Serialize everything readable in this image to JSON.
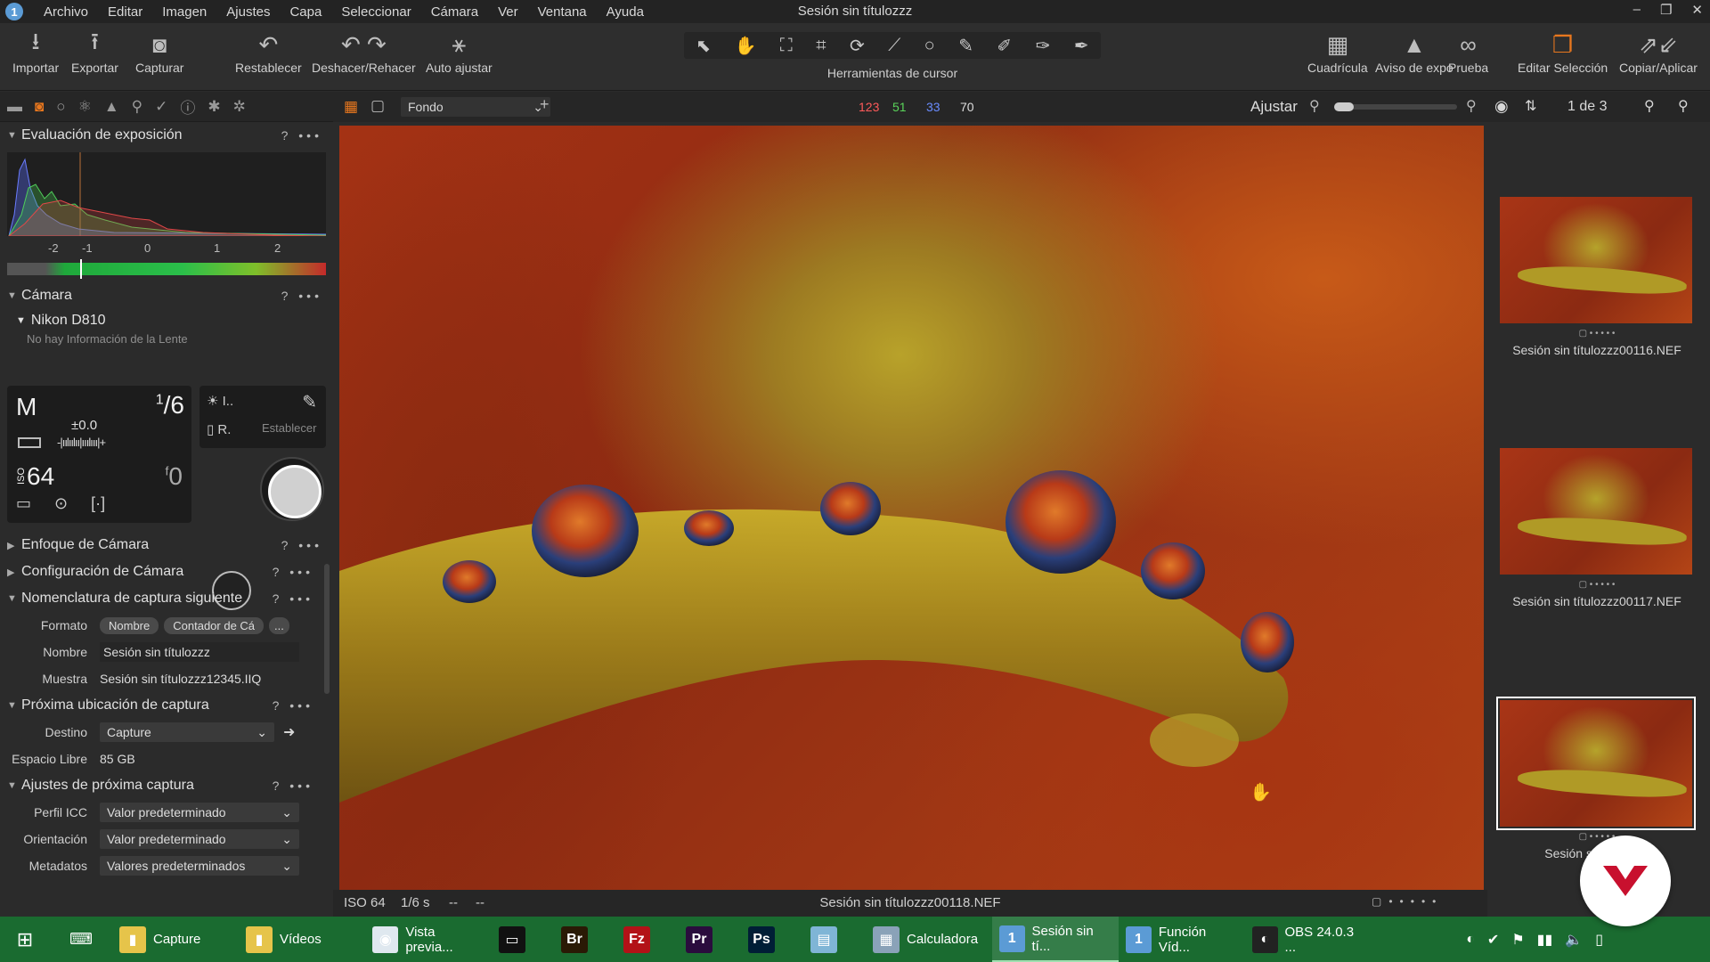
{
  "window": {
    "title": "Sesión sin títulozzz",
    "controls": [
      "–",
      "❐",
      "✕"
    ]
  },
  "menu": [
    "Archivo",
    "Editar",
    "Imagen",
    "Ajustes",
    "Capa",
    "Seleccionar",
    "Cámara",
    "Ver",
    "Ventana",
    "Ayuda"
  ],
  "toolbar": {
    "left": [
      {
        "label": "Importar",
        "icon": "import-icon",
        "glyph": "⭳"
      },
      {
        "label": "Exportar",
        "icon": "export-icon",
        "glyph": "⭱"
      },
      {
        "label": "Capturar",
        "icon": "camera-icon",
        "glyph": "◙"
      },
      {
        "label": "Restablecer",
        "icon": "reset-icon",
        "glyph": "↶"
      },
      {
        "label": "Deshacer/Rehacer",
        "icon": "undo-redo-icon",
        "glyph": "↶ ↷"
      },
      {
        "label": "Auto ajustar",
        "icon": "magic-wand-icon",
        "glyph": "⚹"
      }
    ],
    "cursor_tools_label": "Herramientas de cursor",
    "cursor_tools": [
      "⬉",
      "✋",
      "⛶",
      "⌗",
      "⟳",
      "⟋",
      "○",
      "✎",
      "✐",
      "✑",
      "✒"
    ],
    "right": [
      {
        "label": "Cuadrícula",
        "icon": "grid-icon",
        "glyph": "▦"
      },
      {
        "label": "Aviso de expo",
        "icon": "exposure-warning-icon",
        "glyph": "▲"
      },
      {
        "label": "Prueba",
        "icon": "proof-glasses-icon",
        "glyph": "∞"
      },
      {
        "label": "Editar Selección",
        "icon": "edit-selection-icon",
        "glyph": "❐"
      },
      {
        "label": "Copiar/Aplicar",
        "icon": "copy-apply-icon",
        "glyph": "⇗⇙"
      }
    ]
  },
  "left_tabs": [
    "▬",
    "◙",
    "○",
    "⚛",
    "▲",
    "⚲",
    "✓",
    "ⓘ",
    "✱",
    "✲"
  ],
  "exposure": {
    "title": "Evaluación de exposición",
    "scale": [
      "-2",
      "-1",
      "0",
      "1",
      "2"
    ]
  },
  "camera": {
    "title": "Cámara",
    "model": "Nikon D810",
    "lens": "No hay Información de la Lente",
    "mode": "M",
    "shutter_num": "1",
    "shutter_den": "6",
    "ev": "±0.0",
    "ev_scale": "-|ıılıılıı|ııılııı|+",
    "iso_label": "ISO",
    "iso": "64",
    "fnum_prefix": "f",
    "fnum": "0",
    "wb_label": "I..",
    "raw_label": "R.",
    "set_label": "Establecer"
  },
  "sections": {
    "focus": "Enfoque de Cámara",
    "config": "Configuración de Cámara",
    "naming": "Nomenclatura de captura siguiente",
    "location": "Próxima ubicación de captura",
    "next": "Ajustes de próxima captura"
  },
  "naming": {
    "format_label": "Formato",
    "format_pill1": "Nombre",
    "format_pill2": "Contador de Cá",
    "format_more": "...",
    "name_label": "Nombre",
    "name_value": "Sesión sin títulozzz",
    "sample_label": "Muestra",
    "sample_value": "Sesión sin títulozzz12345.IIQ"
  },
  "location": {
    "dest_label": "Destino",
    "dest_value": "Capture",
    "free_label": "Espacio Libre",
    "free_value": "85 GB"
  },
  "next_capture": {
    "icc_label": "Perfil ICC",
    "icc_value": "Valor predeterminado",
    "orient_label": "Orientación",
    "orient_value": "Valor predeterminado",
    "meta_label": "Metadatos",
    "meta_value": "Valores predeterminados"
  },
  "viewer_header": {
    "layer": "Fondo",
    "rgb_r": "123",
    "rgb_g": "51",
    "rgb_b": "33",
    "rgb_l": "70",
    "fit_label": "Ajustar",
    "count": "1 de 3"
  },
  "status": {
    "iso": "ISO 64",
    "shutter": "1/6 s",
    "aperture": "--",
    "focal": "--",
    "filename": "Sesión sin títulozzz00118.NEF"
  },
  "thumbnails": [
    {
      "name": "Sesión sin títulozzz00116.NEF"
    },
    {
      "name": "Sesión sin títulozzz00117.NEF"
    },
    {
      "name": "Sesión sin títu...EF"
    }
  ],
  "taskbar": {
    "items": [
      {
        "label": "Capture",
        "icon": "folder-icon",
        "color": "#e6c44a",
        "glyph": "▮"
      },
      {
        "label": "Vídeos",
        "icon": "folder-icon",
        "color": "#e6c44a",
        "glyph": "▮"
      },
      {
        "label": "Vista previa...",
        "icon": "chrome-icon",
        "color": "#dfe8ef",
        "glyph": "◉"
      },
      {
        "label": "",
        "icon": "terminal-icon",
        "color": "#111111",
        "glyph": "▭"
      },
      {
        "label": "",
        "icon": "bridge-icon",
        "color": "#2a1a05",
        "glyph": "Br"
      },
      {
        "label": "",
        "icon": "filezilla-icon",
        "color": "#b31217",
        "glyph": "Fz"
      },
      {
        "label": "",
        "icon": "premiere-icon",
        "color": "#2a0c3d",
        "glyph": "Pr"
      },
      {
        "label": "",
        "icon": "photoshop-icon",
        "color": "#001e36",
        "glyph": "Ps"
      },
      {
        "label": "",
        "icon": "archive-icon",
        "color": "#7fb5d6",
        "glyph": "▤"
      },
      {
        "label": "Calculadora",
        "icon": "calculator-icon",
        "color": "#8aa2b8",
        "glyph": "▦"
      },
      {
        "label": "Sesión sin tí...",
        "icon": "capture-one-icon",
        "color": "#5b9bd5",
        "glyph": "1"
      },
      {
        "label": "Función Víd...",
        "icon": "capture-one-icon",
        "color": "#5b9bd5",
        "glyph": "1"
      },
      {
        "label": "OBS 24.0.3 ...",
        "icon": "obs-icon",
        "color": "#222222",
        "glyph": "◐"
      }
    ],
    "tray": [
      "◐",
      "✔",
      "⚑",
      "▮▮",
      "🔈",
      "▯"
    ]
  }
}
